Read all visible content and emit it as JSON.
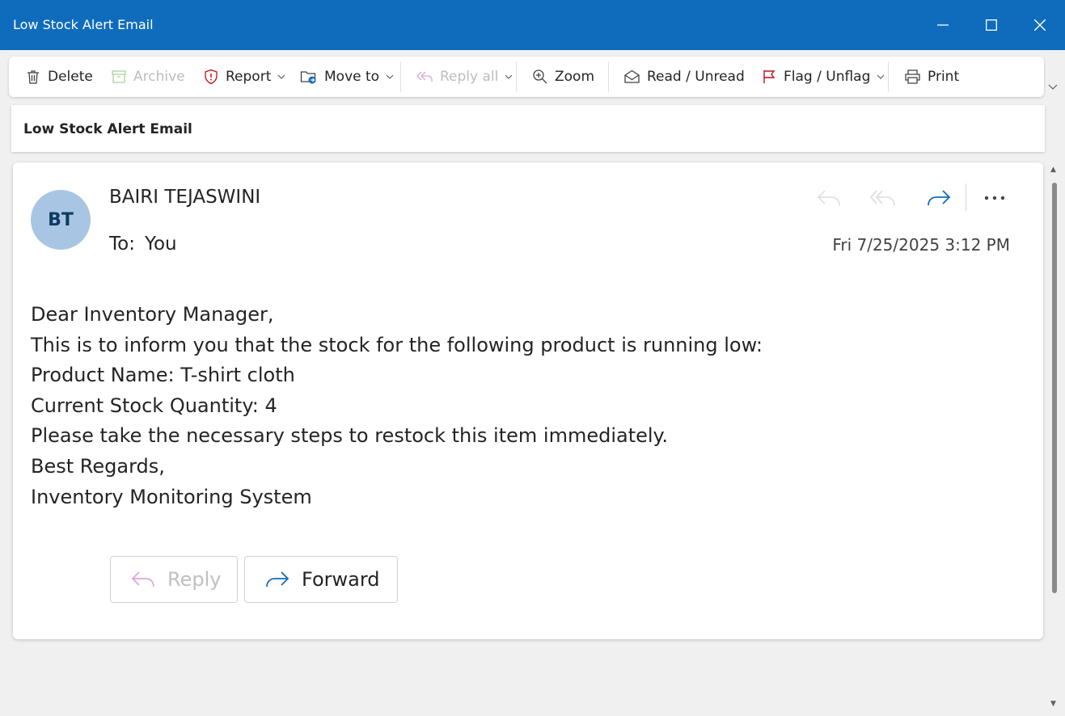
{
  "window": {
    "title": "Low Stock Alert Email"
  },
  "toolbar": {
    "delete": "Delete",
    "archive": "Archive",
    "report": "Report",
    "move_to": "Move to",
    "reply_all": "Reply all",
    "zoom": "Zoom",
    "read_unread": "Read / Unread",
    "flag_unflag": "Flag / Unflag",
    "print": "Print"
  },
  "subject": "Low Stock Alert Email",
  "message": {
    "avatar_initials": "BT",
    "sender": "BAIRI TEJASWINI",
    "to_label": "To:",
    "to_value": "You",
    "date": "Fri 7/25/2025 3:12 PM",
    "body_lines": [
      "Dear Inventory Manager,",
      "This is to inform you that the stock for the following product is running low:",
      "Product Name: T-shirt cloth",
      "Current Stock Quantity: 4",
      "Please take the necessary steps to restock this item immediately.",
      "Best Regards,",
      "Inventory Monitoring System"
    ],
    "reply_label": "Reply",
    "forward_label": "Forward"
  },
  "colors": {
    "titlebar": "#0f6cbd",
    "avatar": "#a8c6e3",
    "accent": "#0f6cbd",
    "report_icon": "#c50f1f",
    "flag_icon": "#c50f1f"
  }
}
